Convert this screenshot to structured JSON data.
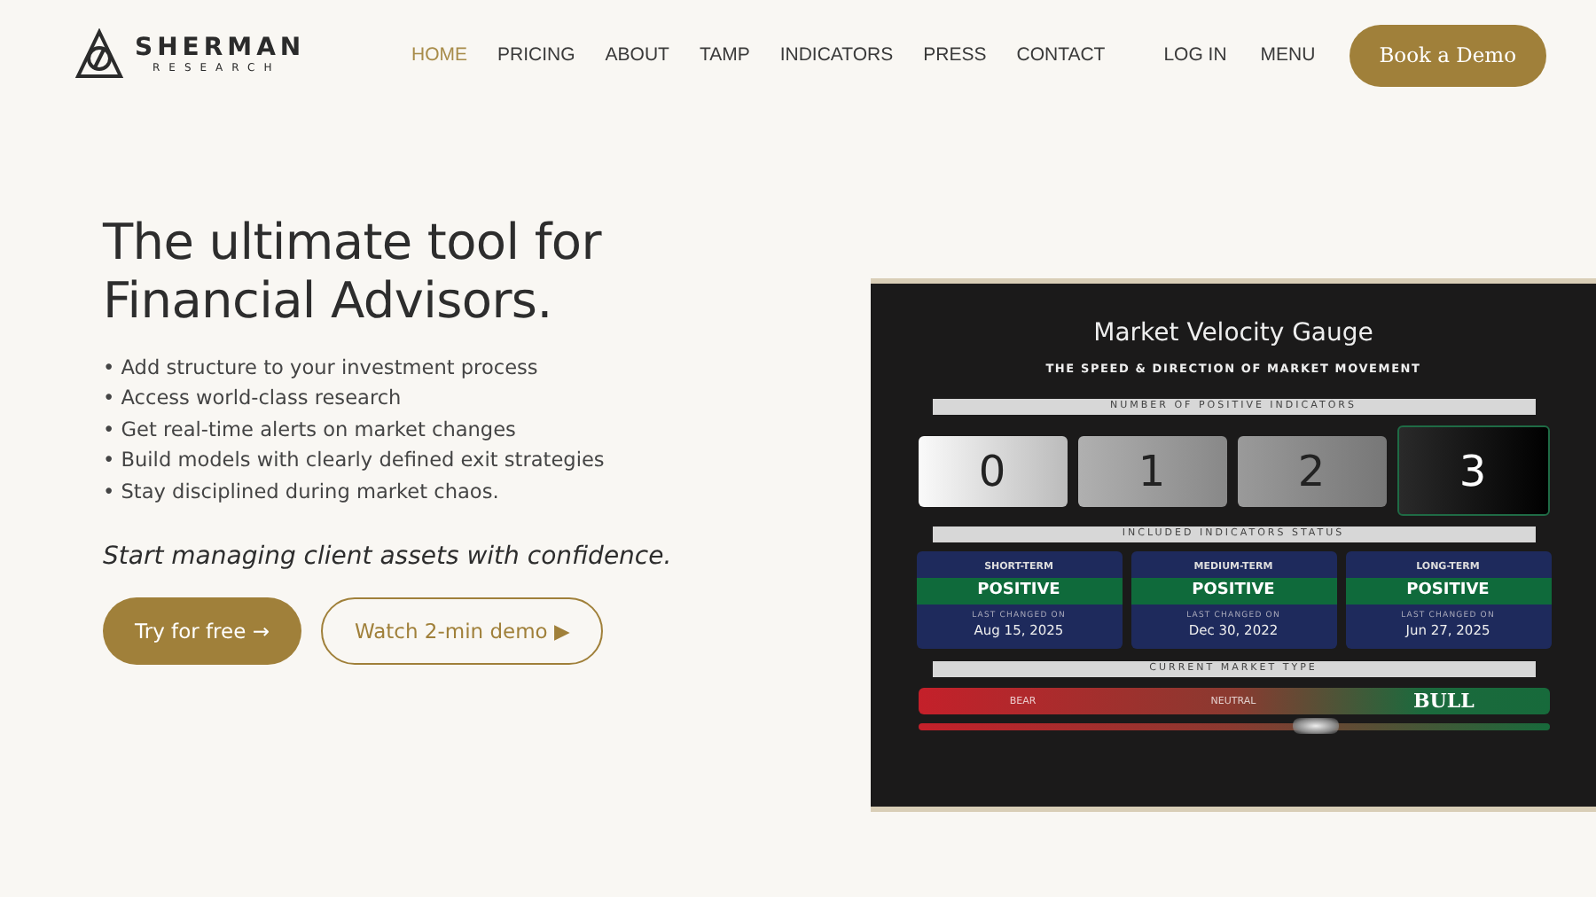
{
  "brand": {
    "name": "SHERMAN",
    "tagline": "RESEARCH"
  },
  "nav": [
    {
      "label": "HOME",
      "selected": true
    },
    {
      "label": "PRICING",
      "selected": false
    },
    {
      "label": "ABOUT",
      "selected": false
    },
    {
      "label": "TAMP",
      "selected": false
    },
    {
      "label": "INDICATORS",
      "selected": false
    },
    {
      "label": "PRESS",
      "selected": false
    },
    {
      "label": "CONTACT",
      "selected": false
    }
  ],
  "nav_right": [
    "LOG IN",
    "MENU"
  ],
  "cta": "Book a Demo",
  "hero": {
    "heading": "The ultimate tool for Financial Advisors.",
    "bullets": [
      "• Add structure to your investment process",
      "• Access world-class research",
      "• Get real-time alerts on market changes",
      "• Build models with clearly defined exit strategies",
      "• Stay disciplined during market chaos."
    ],
    "tagline": "Start managing client assets with confidence.",
    "buttons": [
      {
        "label": "Try for free →",
        "kind": "primary"
      },
      {
        "label": "Watch 2-min demo ▶",
        "kind": "outline"
      }
    ]
  },
  "gauge": {
    "title": "Market Velocity Gauge",
    "subtitle": "THE SPEED & DIRECTION OF MARKET MOVEMENT",
    "count_label": "NUMBER OF POSITIVE INDICATORS",
    "counts": [
      {
        "label": "0",
        "selected": false
      },
      {
        "label": "1",
        "selected": false
      },
      {
        "label": "2",
        "selected": false
      },
      {
        "label": "3",
        "selected": true
      }
    ],
    "status_label": "INCLUDED INDICATORS STATUS",
    "indicators": [
      {
        "term": "SHORT-TERM",
        "status": "POSITIVE",
        "changed_label": "LAST CHANGED ON",
        "date": "Aug 15, 2025"
      },
      {
        "term": "MEDIUM-TERM",
        "status": "POSITIVE",
        "changed_label": "LAST CHANGED ON",
        "date": "Dec 30, 2022"
      },
      {
        "term": "LONG-TERM",
        "status": "POSITIVE",
        "changed_label": "LAST CHANGED ON",
        "date": "Jun 27, 2025"
      }
    ],
    "market_label": "CURRENT MARKET TYPE",
    "market_types": [
      {
        "label": "BEAR",
        "selected": false
      },
      {
        "label": "NEUTRAL",
        "selected": false
      },
      {
        "label": "BULL",
        "selected": true
      }
    ],
    "market_marker": {
      "level": 0.63
    }
  }
}
